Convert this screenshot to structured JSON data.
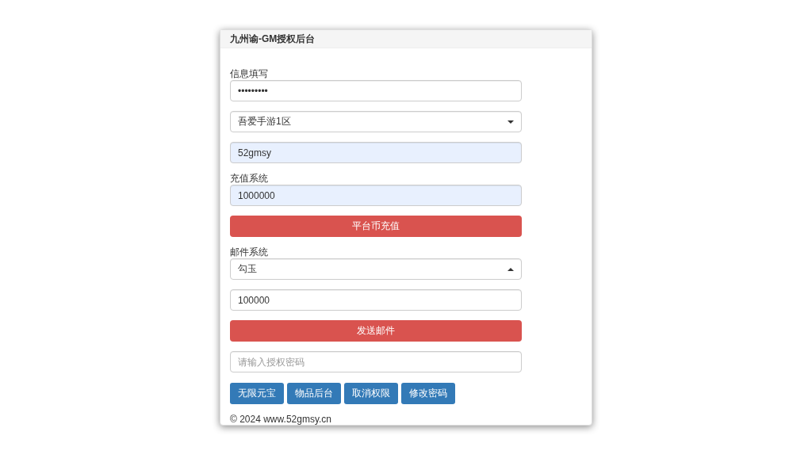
{
  "panel": {
    "title": "九州谕-GM授权后台"
  },
  "form": [
    {
      "kind": "label",
      "text": "信息填写"
    },
    {
      "kind": "input",
      "value": "•••••••••",
      "autofilled": false
    },
    {
      "kind": "select",
      "value": "吾爱手游1区",
      "expanded": false
    },
    {
      "kind": "input",
      "value": "52gmsy",
      "autofilled": true
    },
    {
      "kind": "label",
      "text": "充值系统"
    },
    {
      "kind": "input",
      "value": "1000000",
      "autofilled": true
    },
    {
      "kind": "button",
      "text": "平台币充值"
    },
    {
      "kind": "label",
      "text": "邮件系统"
    },
    {
      "kind": "select",
      "value": "勾玉",
      "expanded": true
    },
    {
      "kind": "input",
      "value": "100000",
      "autofilled": false
    },
    {
      "kind": "button",
      "text": "发送邮件"
    },
    {
      "kind": "input",
      "placeholder": "请输入授权密码",
      "autofilled": false
    }
  ],
  "actions": [
    "无限元宝",
    "物品后台",
    "取消权限",
    "修改密码"
  ],
  "footer": "© 2024 www.52gmsy.cn"
}
